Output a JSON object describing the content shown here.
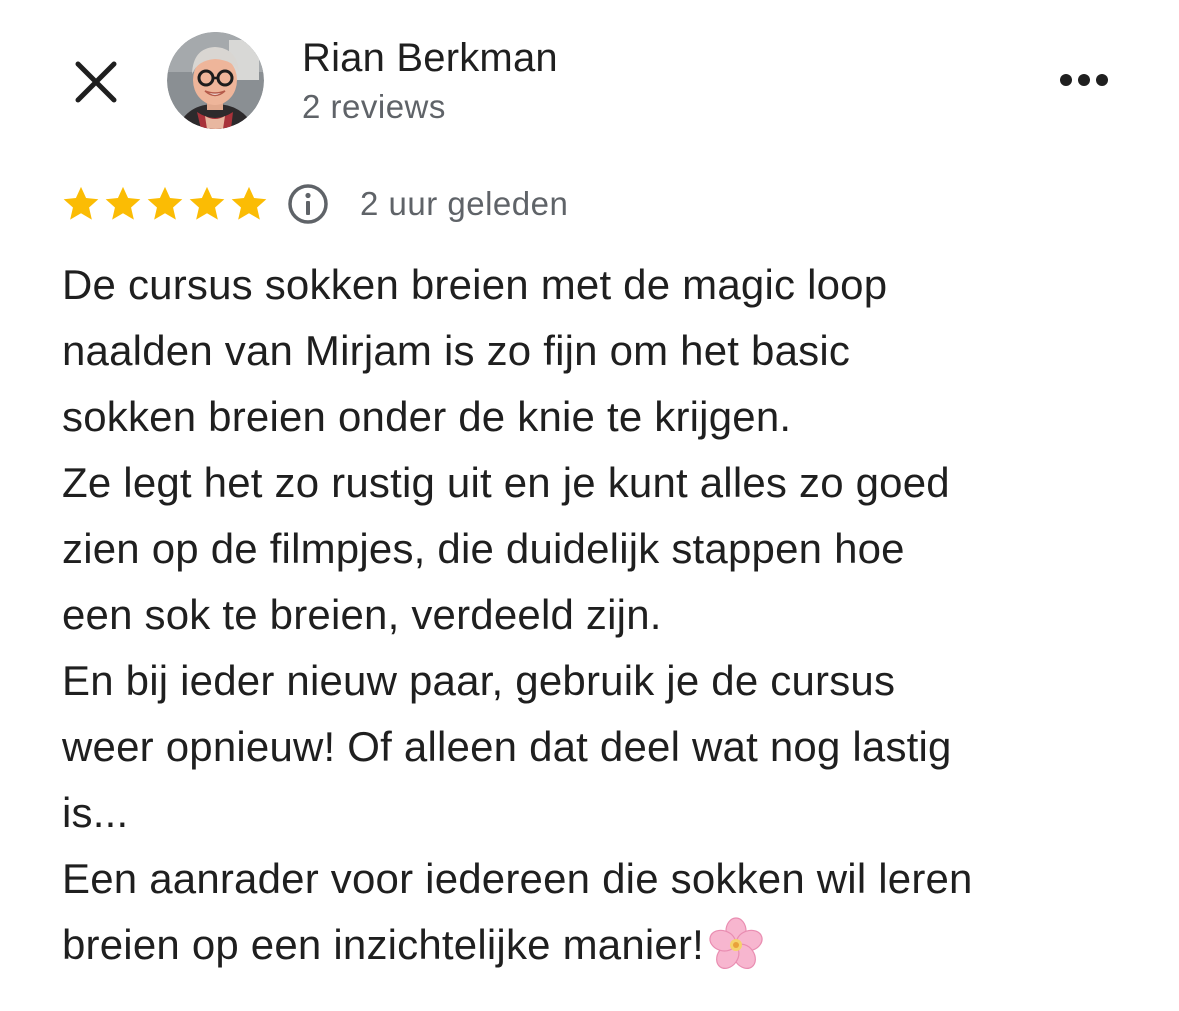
{
  "header": {
    "close_icon": "close-icon",
    "author_name": "Rian Berkman",
    "review_count": "2 reviews",
    "more_icon": "more-horizontal-icon"
  },
  "rating": {
    "stars": 5,
    "max_stars": 5,
    "star_color": "#fbbc04",
    "info_icon": "info-icon",
    "time_ago": "2 uur geleden"
  },
  "review": {
    "lines": [
      "De cursus sokken breien met de magic loop",
      "naalden van Mirjam is zo fijn om het basic",
      "sokken breien onder de knie te krijgen.",
      "Ze legt het zo rustig uit en je kunt alles zo goed",
      "zien op de filmpjes, die duidelijk stappen hoe",
      "een sok te breien, verdeeld zijn.",
      "En bij ieder nieuw paar, gebruik je de cursus",
      "weer opnieuw! Of alleen dat deel wat nog lastig",
      "is...",
      "Een aanrader voor iedereen die sokken wil leren",
      "breien op een inzichtelijke manier!"
    ],
    "trailing_emoji": "cherry-blossom-icon"
  },
  "colors": {
    "text_primary": "#1f1f1f",
    "text_secondary": "#5f6368",
    "star": "#fbbc04"
  }
}
